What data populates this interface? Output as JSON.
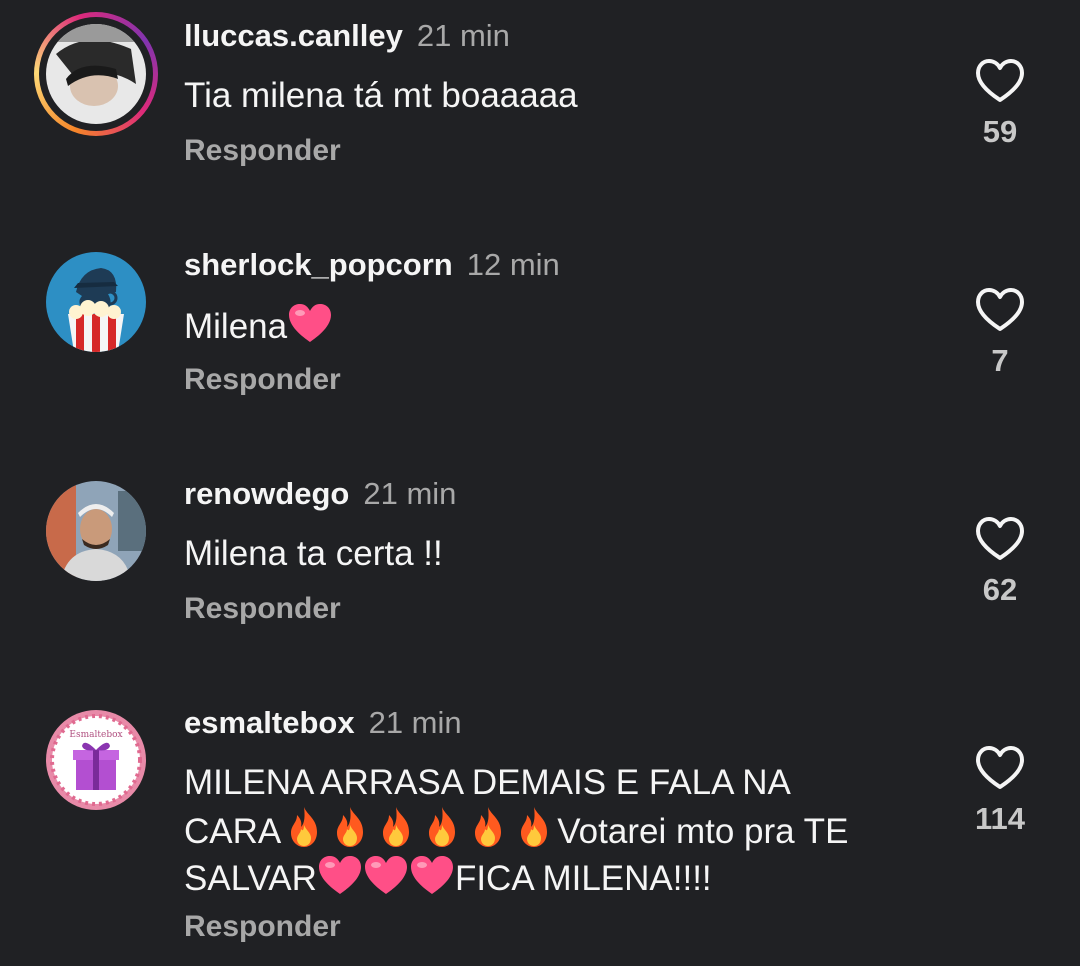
{
  "comments": [
    {
      "username": "lluccas.canlley",
      "time": "21 min",
      "text": "Tia milena tá mt boaaaaa",
      "reply_label": "Responder",
      "likes": "59",
      "avatar": "user-photo-avatar",
      "story_ring": true
    },
    {
      "username": "sherlock_popcorn",
      "time": "12 min",
      "text": "Milena",
      "reply_label": "Responder",
      "likes": "7",
      "avatar": "sherlock-popcorn-avatar"
    },
    {
      "username": "renowdego",
      "time": "21 min",
      "text": "Milena ta certa !!",
      "reply_label": "Responder",
      "likes": "62",
      "avatar": "man-with-cap-avatar"
    },
    {
      "username": "esmaltebox",
      "time": "21 min",
      "text_line1": "MILENA ARRASA DEMAIS E FALA NA",
      "text_line2_a": "CARA",
      "text_line2_b": "Votarei mto pra TE",
      "text_line3_a": "SALVAR",
      "text_line3_b": "FICA MILENA!!!!",
      "reply_label": "Responder",
      "likes": "114",
      "avatar": "gift-box-avatar",
      "avatar_text": "Esmaltebox"
    }
  ],
  "icons": {
    "like": "heart-outline-icon",
    "emoji_heart": "pink-heart-emoji",
    "emoji_fire": "fire-emoji"
  },
  "colors": {
    "background": "#202124",
    "primary_text": "#f5f5f5",
    "secondary_text": "#a8a8a8"
  }
}
